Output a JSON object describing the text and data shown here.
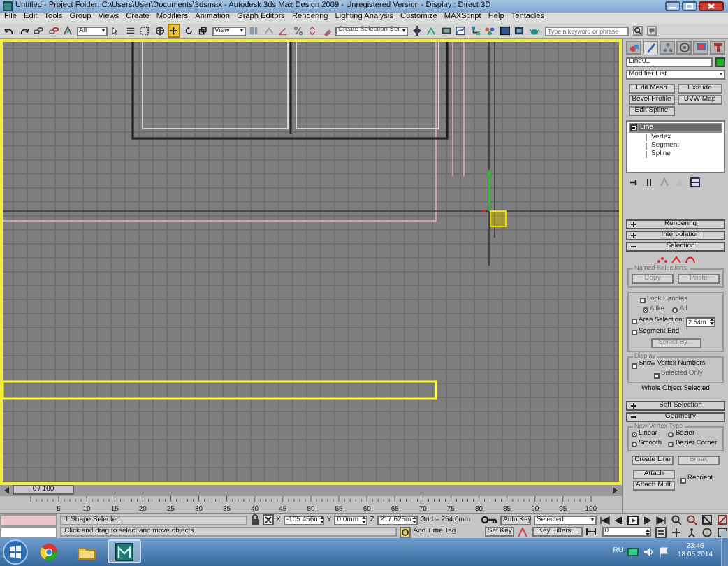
{
  "window": {
    "title": "Untitled   - Project Folder: C:\\Users\\User\\Documents\\3dsmax   - Autodesk 3ds Max Design 2009   - Unregistered Version   - Display : Direct 3D"
  },
  "menu": [
    "File",
    "Edit",
    "Tools",
    "Group",
    "Views",
    "Create",
    "Modifiers",
    "Animation",
    "Graph Editors",
    "Rendering",
    "Lighting Analysis",
    "Customize",
    "MAXScript",
    "Help",
    "Tentacles"
  ],
  "toolbar": {
    "selection_filter": "All",
    "reference_coord": "View",
    "named_selection": "Create Selection Set",
    "search": {
      "placeholder": "Type a keyword or phrase"
    },
    "transform_tools": [
      {
        "kind": "select",
        "selected": false
      },
      {
        "kind": "move",
        "selected": true
      },
      {
        "kind": "rotate",
        "selected": false
      },
      {
        "kind": "scale",
        "selected": false
      }
    ]
  },
  "command_panel": {
    "tabs": [
      {
        "kind": "create",
        "selected": false
      },
      {
        "kind": "modify",
        "selected": true
      },
      {
        "kind": "hierarchy",
        "selected": false
      },
      {
        "kind": "motion",
        "selected": false
      },
      {
        "kind": "display",
        "selected": false
      },
      {
        "kind": "utilities",
        "selected": false
      }
    ],
    "object_name": "Line01",
    "modifier_list": "Modifier List",
    "modifier_buttons": [
      "Edit Mesh",
      "Extrude",
      "Bevel Profile",
      "UVW Map",
      "Edit Spline"
    ],
    "stack": [
      {
        "label": "Line",
        "selected": true,
        "expanded": true,
        "children": [
          {
            "label": "Vertex",
            "selected": false
          },
          {
            "label": "Segment",
            "selected": false
          },
          {
            "label": "Spline",
            "selected": false
          }
        ]
      }
    ],
    "rollouts": [
      {
        "kind": "collapsed",
        "title": "Rendering",
        "expanded": false
      },
      {
        "kind": "collapsed",
        "title": "Interpolation",
        "expanded": false
      },
      {
        "kind": "selection",
        "title": "Selection",
        "expanded": true,
        "named_selections": {
          "title": "Named Selections:",
          "buttons": [
            {
              "label": "Copy",
              "disabled": true
            },
            {
              "label": "Paste",
              "disabled": true
            }
          ]
        },
        "lock_handles": {
          "label": "Lock Handles",
          "checked": false,
          "disabled": true
        },
        "handle_mode": [
          {
            "label": "Alike",
            "selected": true,
            "disabled": true
          },
          {
            "label": "All",
            "selected": false,
            "disabled": true
          }
        ],
        "area_selection": {
          "label": "Area Selection:",
          "checked": false,
          "value": "2.54m"
        },
        "segment_end": {
          "label": "Segment End",
          "checked": false
        },
        "select_by": {
          "label": "Select By...",
          "disabled": true
        },
        "display": {
          "title": "Display",
          "options": [
            {
              "label": "Show Vertex Numbers",
              "checked": false,
              "disabled": false
            },
            {
              "label": "Selected Only",
              "checked": false,
              "disabled": true
            }
          ]
        },
        "status": "Whole Object Selected"
      },
      {
        "kind": "collapsed",
        "title": "Soft Selection",
        "expanded": false
      },
      {
        "kind": "geometry",
        "title": "Geometry",
        "expanded": true,
        "new_vertex_type": {
          "title": "New Vertex Type",
          "options": [
            {
              "label": "Linear",
              "selected": true
            },
            {
              "label": "Bezier",
              "selected": false
            },
            {
              "label": "Smooth",
              "selected": false
            },
            {
              "label": "Bezier Corner",
              "selected": false
            }
          ]
        },
        "create_line": {
          "label": "Create Line",
          "disabled": false
        },
        "break": {
          "label": "Break",
          "disabled": true
        },
        "attach": {
          "label": "Attach",
          "disabled": false
        },
        "reorient": {
          "label": "Reorient",
          "checked": false
        },
        "attach_mult": {
          "label": "Attach Mult.",
          "disabled": false
        }
      }
    ]
  },
  "time_slider": {
    "position": "0 / 100",
    "level": 0
  },
  "ruler": [
    "5",
    "10",
    "15",
    "20",
    "25",
    "30",
    "35",
    "40",
    "45",
    "50",
    "55",
    "60",
    "65",
    "70",
    "75",
    "80",
    "85",
    "90",
    "95",
    "100"
  ],
  "status": {
    "selection": "1 Shape Selected",
    "prompt": "Click and drag to select and move objects",
    "x_label": "X",
    "x": "-105.456m",
    "y_label": "Y",
    "y": "0.0mm",
    "z_label": "Z",
    "z": "217.625m",
    "grid": "Grid = 254.0mm",
    "add_time_tag": "Add Time Tag",
    "auto_key": "Auto Key",
    "key_mode": "Selected",
    "set_key": "Set Key",
    "key_filters": "Key Filters...",
    "frame": "0"
  },
  "taskbar": {
    "apps": [
      {
        "kind": "browser"
      },
      {
        "kind": "folder"
      },
      {
        "kind": "max",
        "selected": true
      }
    ],
    "language": "RU",
    "time": "23:46",
    "date": "18.05.2014"
  }
}
